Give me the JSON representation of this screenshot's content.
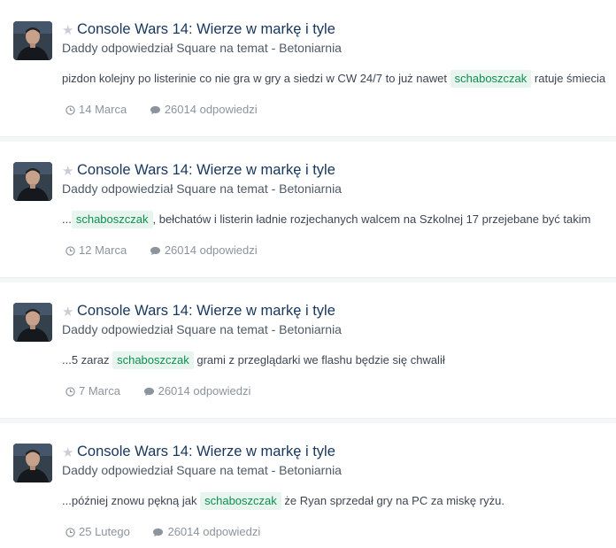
{
  "results": [
    {
      "title": "Console Wars 14: Wierze w markę i tyle",
      "meta": "Daddy odpowiedział Square na temat - Betoniarnia",
      "snippet_before": "pizdon kolejny po listerinie co nie gra w gry a siedzi w CW 24/7 to już nawet",
      "highlight": "schaboszczak",
      "snippet_after": "ratuje śmiecia",
      "date": "14 Marca",
      "replies": "26014 odpowiedzi"
    },
    {
      "title": "Console Wars 14: Wierze w markę i tyle",
      "meta": "Daddy odpowiedział Square na temat - Betoniarnia",
      "snippet_before": "...",
      "highlight": "schaboszczak",
      "snippet_after": ", bełchatów i listerin ładnie rozjechanych walcem na Szkolnej 17 przejebane być takim",
      "date": "12 Marca",
      "replies": "26014 odpowiedzi"
    },
    {
      "title": "Console Wars 14: Wierze w markę i tyle",
      "meta": "Daddy odpowiedział Square na temat - Betoniarnia",
      "snippet_before": "...5 zaraz",
      "highlight": "schaboszczak",
      "snippet_after": "grami z przeglądarki we flashu będzie się chwalił",
      "date": "7 Marca",
      "replies": "26014 odpowiedzi"
    },
    {
      "title": "Console Wars 14: Wierze w markę i tyle",
      "meta": "Daddy odpowiedział Square na temat - Betoniarnia",
      "snippet_before": "...później znowu pękną jak",
      "highlight": "schaboszczak",
      "snippet_after": "że Ryan sprzedał gry na PC za miskę ryżu.",
      "date": "25 Lutego",
      "replies": "26014 odpowiedzi"
    }
  ],
  "icons": {
    "star": "star-icon",
    "clock": "clock-icon",
    "comment": "comment-icon",
    "avatar": "avatar"
  },
  "colors": {
    "title": "#16365c",
    "highlight_text": "#0d8f51",
    "highlight_bg": "#e8f5ee",
    "muted": "#8c949d",
    "star": "#c9ced6"
  }
}
